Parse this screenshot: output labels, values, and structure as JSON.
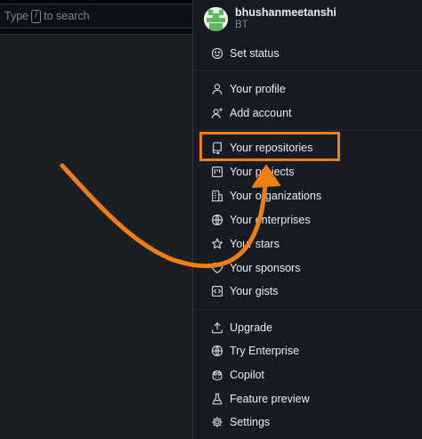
{
  "search": {
    "prefix": "Type",
    "key": "/",
    "suffix": "to search"
  },
  "profile": {
    "username": "bhushanmeetanshi",
    "display_name": "BT"
  },
  "menu": {
    "status": "Set status",
    "profile": "Your profile",
    "add_account": "Add account",
    "repositories": "Your repositories",
    "projects": "Your projects",
    "organizations": "Your organizations",
    "enterprises": "Your enterprises",
    "stars": "Your stars",
    "sponsors": "Your sponsors",
    "gists": "Your gists",
    "upgrade": "Upgrade",
    "try_enterprise": "Try Enterprise",
    "copilot": "Copilot",
    "feature_preview": "Feature preview",
    "settings": "Settings"
  },
  "colors": {
    "highlight": "#f07f13",
    "panel": "#161b22",
    "text": "#e6edf3",
    "muted": "#7d8590"
  },
  "icons": {
    "avatar": "identicon-avatar",
    "status": "smiley-icon",
    "profile": "person-icon",
    "add_account": "person-add-icon",
    "repositories": "repo-icon",
    "projects": "project-icon",
    "organizations": "organization-icon",
    "enterprises": "globe-icon",
    "stars": "star-icon",
    "sponsors": "heart-icon",
    "gists": "code-square-icon",
    "upgrade": "upload-icon",
    "try_enterprise": "globe-icon",
    "copilot": "copilot-icon",
    "feature_preview": "beaker-icon",
    "settings": "gear-icon"
  }
}
